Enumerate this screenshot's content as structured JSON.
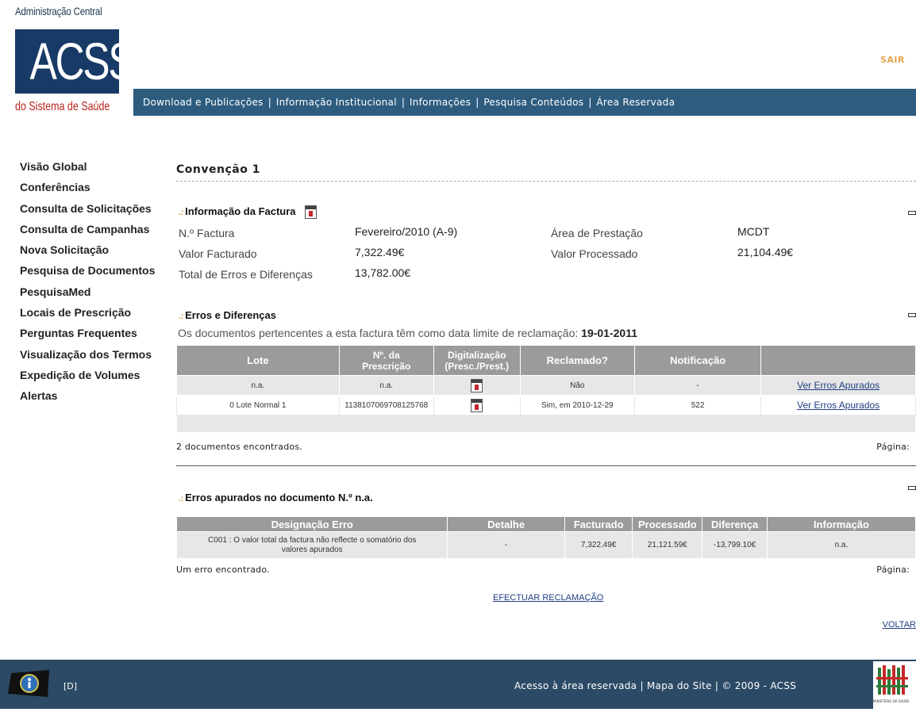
{
  "header": {
    "logo_top": "Administração Central",
    "logo_main": "ACSS",
    "logo_bottom": "do Sistema de Saúde",
    "sair": "SAIR",
    "nav": [
      "Download e Publicações",
      "Informação Institucional",
      "Informações",
      "Pesquisa Conteúdos",
      "Área Reservada"
    ],
    "nav_separator": "|"
  },
  "sidebar": {
    "items": [
      "Visão Global",
      "Conferências",
      "Consulta de Solicitações",
      "Consulta de Campanhas",
      "Nova Solicitação",
      "Pesquisa de Documentos",
      "PesquisaMed",
      "Locais de Prescrição",
      "Perguntas Frequentes",
      "Visualização dos Termos",
      "Expedição de Volumes",
      "Alertas"
    ]
  },
  "main": {
    "title": "Convenção 1",
    "section_marker": ".:",
    "info": {
      "title": "Informação da Factura",
      "fields": {
        "factura_label": "N.º Factura",
        "factura_value": "Fevereiro/2010 (A-9)",
        "area_label": "Área de Prestação",
        "area_value": "MCDT",
        "valor_fact_label": "Valor Facturado",
        "valor_fact_value": "7,322.49€",
        "valor_proc_label": "Valor Processado",
        "valor_proc_value": "21,104.49€",
        "total_label": "Total de Erros e Diferenças",
        "total_value": "13,782.00€"
      }
    },
    "erros": {
      "title": "Erros e Diferenças",
      "notice": "Os documentos pertencentes a esta factura têm como data limite de reclamação: ",
      "notice_date": "19-01-2011",
      "columns": [
        "Lote",
        "Nº. da Prescrição",
        "Digitalização (Presc./Prest.)",
        "Reclamado?",
        "Notificação",
        ""
      ],
      "col_prescricao": [
        "Nº. da",
        "Prescrição"
      ],
      "col_digitalizacao": [
        "Digitalização",
        "(Presc./Prest.)"
      ],
      "rows": [
        {
          "lote": "n.a.",
          "prescricao": "n.a.",
          "reclamado": "Não",
          "notificacao": "-",
          "link": "Ver Erros Apurados"
        },
        {
          "lote": "0 Lote Normal 1",
          "prescricao": "1138107069708125768",
          "reclamado": "Sim, em 2010-12-29",
          "notificacao": "522",
          "link": "Ver Erros Apurados"
        }
      ],
      "count": "2 documentos encontrados.",
      "pagina": "Página:"
    },
    "apurados": {
      "title": "Erros apurados no documento N.º n.a.",
      "columns": [
        "Designação Erro",
        "Detalhe",
        "Facturado",
        "Processado",
        "Diferença",
        "Informação"
      ],
      "rows": [
        {
          "designacao_1": "C001 : O valor total da factura não reflecte o somatório dos",
          "designacao_2": "valores apurados",
          "detalhe": "-",
          "facturado": "7,322.49€",
          "processado": "21,121.59€",
          "diferenca": "-13,799.10€",
          "informacao": "n.a."
        }
      ],
      "count": "Um erro encontrado.",
      "pagina": "Página:"
    },
    "efectuar": "EFECTUAR RECLAMAÇÃO",
    "voltar": "VOLTAR"
  },
  "footer": {
    "d_label": "[D]",
    "links": "Acesso à área reservada | Mapa do Site | © 2009 - ACSS",
    "ministerio": "MINISTÉRIO DA SAÚDE"
  },
  "colors": {
    "navbar": "#2d5c7e",
    "logo": "#173a66",
    "footer": "#2c4a66",
    "table_header": "#9b9b9b",
    "sair": "#e1a64f"
  }
}
